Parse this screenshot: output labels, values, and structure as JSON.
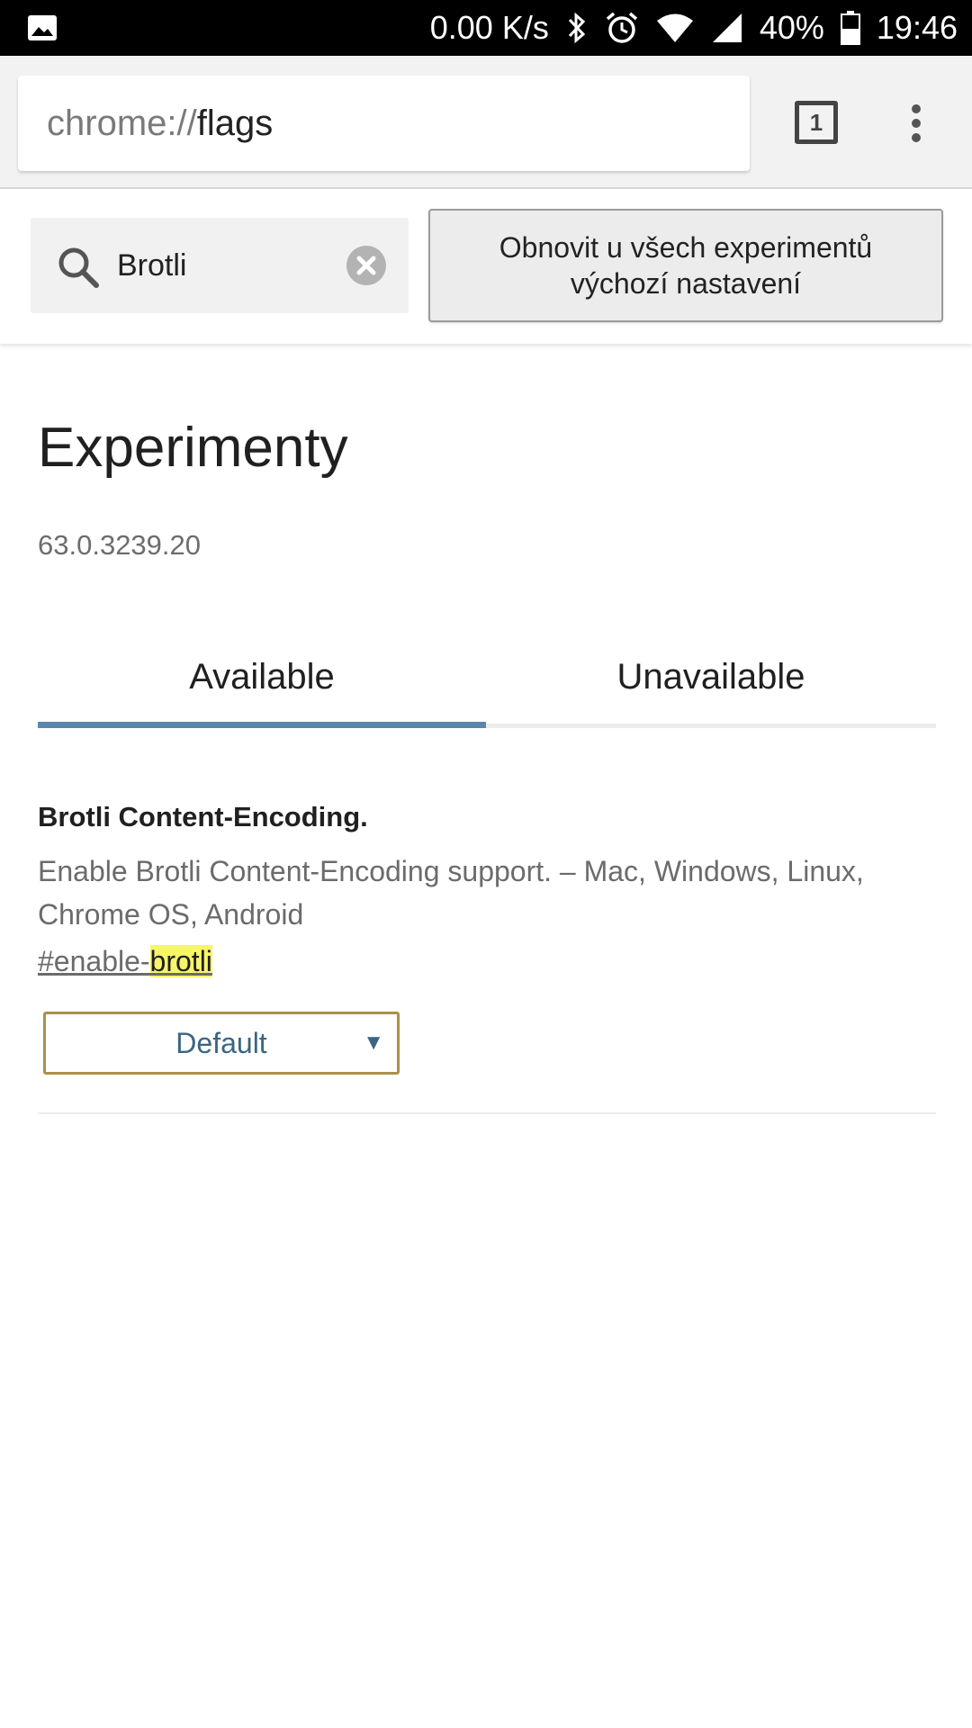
{
  "status_bar": {
    "network_speed": "0.00 K/s",
    "battery": "40%",
    "time": "19:46",
    "icons": [
      "image-icon",
      "bluetooth-icon",
      "alarm-icon",
      "wifi-icon",
      "signal-icon",
      "battery-icon"
    ]
  },
  "toolbar": {
    "url_scheme": "chrome://",
    "url_host": "flags",
    "tab_count": "1"
  },
  "header": {
    "search_value": "Brotli",
    "reset_line1": "Obnovit u všech experimentů",
    "reset_line2": "výchozí nastavení"
  },
  "page": {
    "title": "Experimenty",
    "version": "63.0.3239.20"
  },
  "tabs": {
    "available": "Available",
    "unavailable": "Unavailable",
    "active": "available"
  },
  "experiment": {
    "title": "Brotli Content-Encoding.",
    "description": "Enable Brotli Content-Encoding support.  – Mac, Windows, Linux, Chrome OS, Android",
    "link_prefix": "#enable-",
    "link_highlight": "brotli",
    "selected_option": "Default"
  },
  "colors": {
    "accent": "#5b87ad",
    "highlight": "#f7f56a",
    "select_border": "#a8914a"
  }
}
